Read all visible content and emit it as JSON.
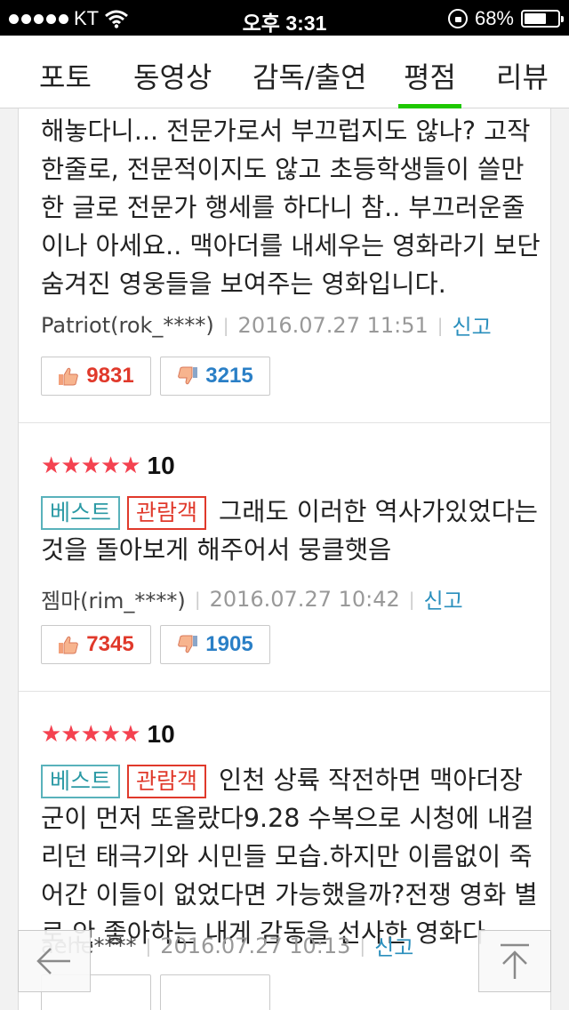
{
  "status_bar": {
    "carrier": "KT",
    "time": "오후 3:31",
    "battery_percent": "68%",
    "battery_level": 0.68
  },
  "tabs": [
    {
      "label": "포토",
      "active": false
    },
    {
      "label": "동영상",
      "active": false
    },
    {
      "label": "감독/출연",
      "active": false
    },
    {
      "label": "평점",
      "active": true
    },
    {
      "label": "리뷰",
      "active": false
    }
  ],
  "reviews": [
    {
      "text_lines": [
        "해놓다니... 전문가로서 부끄럽지도 않나? 고작",
        "한줄로, 전문적이지도 않고 초등학생들이 쓸만",
        "한 글로 전문가 행세를 하다니 참.. 부끄러운줄",
        "이나 아세요.. 맥아더를 내세우는 영화라기 보단",
        "숨겨진 영웅들을 보여주는 영화입니다."
      ],
      "user": "Patriot(rok_****)",
      "date": "2016.07.27 11:51",
      "report": "신고",
      "likes": "9831",
      "dislikes": "3215"
    },
    {
      "stars": "★★★★★",
      "score": "10",
      "badge_best": "베스트",
      "badge_audience": "관람객",
      "text_first": "그래도 이러한 역사가있었다는",
      "text_lines": [
        "것을 돌아보게 해주어서 뭉클햇음"
      ],
      "user": "젬마(rim_****)",
      "date": "2016.07.27 10:42",
      "report": "신고",
      "likes": "7345",
      "dislikes": "1905"
    },
    {
      "stars": "★★★★★",
      "score": "10",
      "badge_best": "베스트",
      "badge_audience": "관람객",
      "text_first": "인천 상륙 작전하면 맥아더장",
      "text_lines": [
        "군이 먼저 또올랐다9.28 수복으로 시청에 내걸",
        "리던 태극기와 시민들 모습.하지만 이름없이 죽",
        "어간 이들이 없었다면 가능했을까?전쟁 영화 별",
        "로 안 좋아하는 내게 감동을 선사한 영화다"
      ],
      "user": "aehe****",
      "date": "2016.07.27 10:13",
      "report": "신고"
    }
  ]
}
